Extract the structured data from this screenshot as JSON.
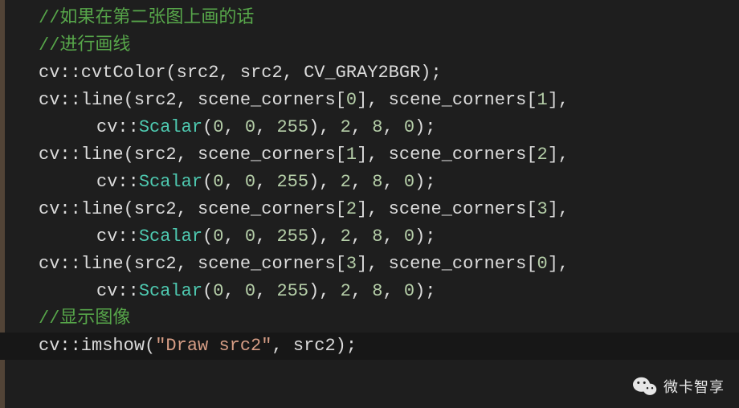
{
  "code": {
    "l1": "//如果在第二张图上画的话",
    "l2": "//进行画线",
    "l3_a": "cv::cvtColor(src2, src2, ",
    "l3_b": "CV_GRAY2BGR",
    "l3_c": ");",
    "l4_a": "cv::line(src2, scene_corners[",
    "l4_b": "0",
    "l4_c": "], scene_corners[",
    "l4_d": "1",
    "l4_e": "],",
    "l5_a": "cv::",
    "l5_b": "Scalar",
    "l5_c": "(",
    "l5_d": "0",
    "l5_e": ", ",
    "l5_f": "0",
    "l5_g": ", ",
    "l5_h": "255",
    "l5_i": "), ",
    "l5_j": "2",
    "l5_k": ", ",
    "l5_l": "8",
    "l5_m": ", ",
    "l5_n": "0",
    "l5_o": ");",
    "l6_a": "cv::line(src2, scene_corners[",
    "l6_b": "1",
    "l6_c": "], scene_corners[",
    "l6_d": "2",
    "l6_e": "],",
    "l8_a": "cv::line(src2, scene_corners[",
    "l8_b": "2",
    "l8_c": "], scene_corners[",
    "l8_d": "3",
    "l8_e": "],",
    "l10_a": "cv::line(src2, scene_corners[",
    "l10_b": "3",
    "l10_c": "], scene_corners[",
    "l10_d": "0",
    "l10_e": "],",
    "l12": "//显示图像",
    "l13_a": "cv::imshow(",
    "l13_b": "\"Draw src2\"",
    "l13_c": ", src2);"
  },
  "watermark": {
    "text": "微卡智享"
  }
}
